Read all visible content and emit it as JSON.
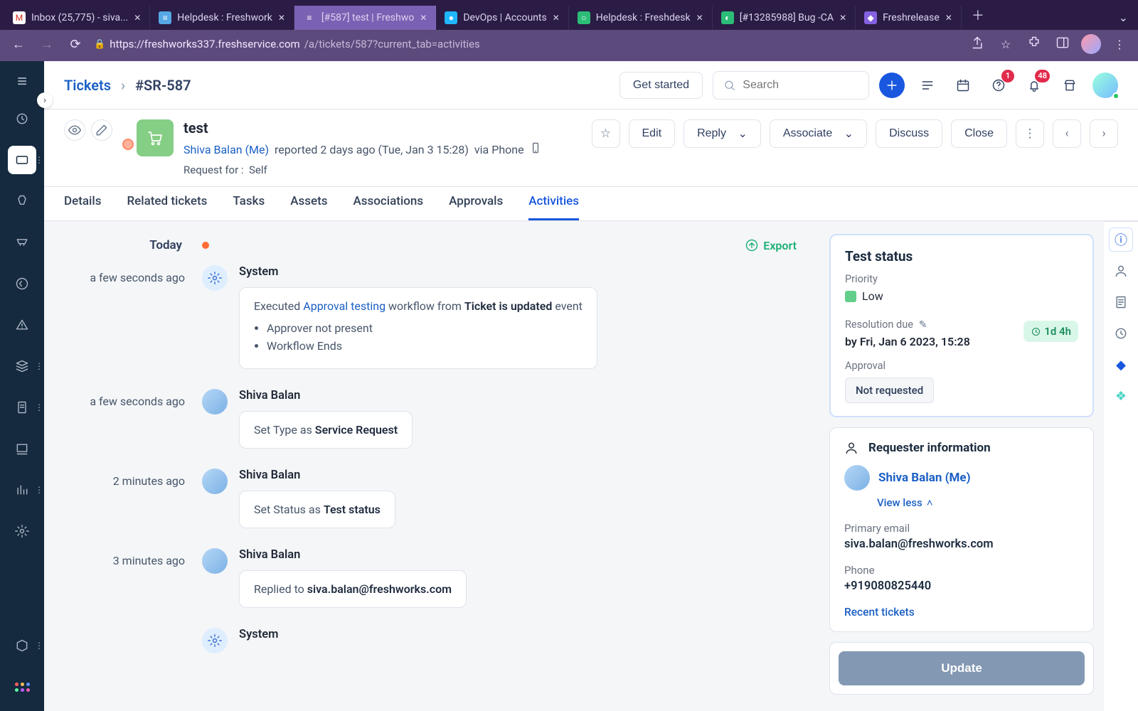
{
  "browser": {
    "tabs": [
      {
        "title": "Inbox (25,775) - siva...",
        "favicon_label": "M",
        "favicon_bg": "#fff"
      },
      {
        "title": "Helpdesk : Freshwork",
        "favicon_label": "≡",
        "favicon_bg": "#56a8e4"
      },
      {
        "title": "[#587] test | Freshwo",
        "favicon_label": "≡",
        "favicon_bg": "#7b61b3",
        "active": true
      },
      {
        "title": "DevOps | Accounts",
        "favicon_label": "●",
        "favicon_bg": "#1fb6ff"
      },
      {
        "title": "Helpdesk : Freshdesk",
        "favicon_label": "○",
        "favicon_bg": "#2bbd77"
      },
      {
        "title": "[#13285988] Bug -CA",
        "favicon_label": "◐",
        "favicon_bg": "#2bbd77"
      },
      {
        "title": "Freshrelease",
        "favicon_label": "◆",
        "favicon_bg": "#8560e0"
      }
    ],
    "url_host": "https://freshworks337.freshservice.com",
    "url_path": "/a/tickets/587?current_tab=activities"
  },
  "header": {
    "breadcrumb_root": "Tickets",
    "breadcrumb_current": "#SR-587",
    "get_started": "Get started",
    "search_placeholder": "Search",
    "badge_help": "1",
    "badge_bell": "48"
  },
  "ticket": {
    "title": "test",
    "requester_link": "Shiva Balan (Me)",
    "reported_line": "reported 2 days ago (Tue, Jan 3 15:28)",
    "via": "via Phone",
    "request_for_label": "Request for :",
    "request_for_value": "Self",
    "actions": {
      "edit": "Edit",
      "reply": "Reply",
      "associate": "Associate",
      "discuss": "Discuss",
      "close": "Close"
    }
  },
  "tabs": {
    "items": [
      "Details",
      "Related tickets",
      "Tasks",
      "Assets",
      "Associations",
      "Approvals",
      "Activities"
    ],
    "active_index": 6
  },
  "activities": {
    "today_label": "Today",
    "export_label": "Export",
    "items": [
      {
        "time": "a few seconds ago",
        "actor": "System",
        "workflow": {
          "prefix": "Executed ",
          "link": "Approval testing",
          "mid": " workflow from ",
          "event": "Ticket is updated",
          "suffix": " event",
          "bullets": [
            "Approver not present",
            "Workflow Ends"
          ]
        }
      },
      {
        "time": "a few seconds ago",
        "actor": "Shiva Balan",
        "set_line": {
          "prefix": "Set Type as ",
          "strong": "Service Request"
        }
      },
      {
        "time": "2 minutes ago",
        "actor": "Shiva Balan",
        "set_line": {
          "prefix": "Set Status as ",
          "strong": "Test status"
        }
      },
      {
        "time": "3 minutes ago",
        "actor": "Shiva Balan",
        "set_line": {
          "prefix": "Replied to ",
          "strong": "siva.balan@freshworks.com"
        }
      },
      {
        "time": "",
        "actor": "System"
      }
    ]
  },
  "right": {
    "status_title": "Test status",
    "priority_label": "Priority",
    "priority_value": "Low",
    "resolution_due_label": "Resolution due",
    "resolution_due_value": "by Fri, Jan 6 2023, 15:28",
    "due_chip": "1d 4h",
    "approval_label": "Approval",
    "approval_value": "Not requested",
    "requester_label": "Requester information",
    "requester_name": "Shiva Balan (Me)",
    "view_less": "View less",
    "email_label": "Primary email",
    "email_value": "siva.balan@freshworks.com",
    "phone_label": "Phone",
    "phone_value": "+919080825440",
    "recent_tickets": "Recent tickets",
    "update": "Update"
  }
}
